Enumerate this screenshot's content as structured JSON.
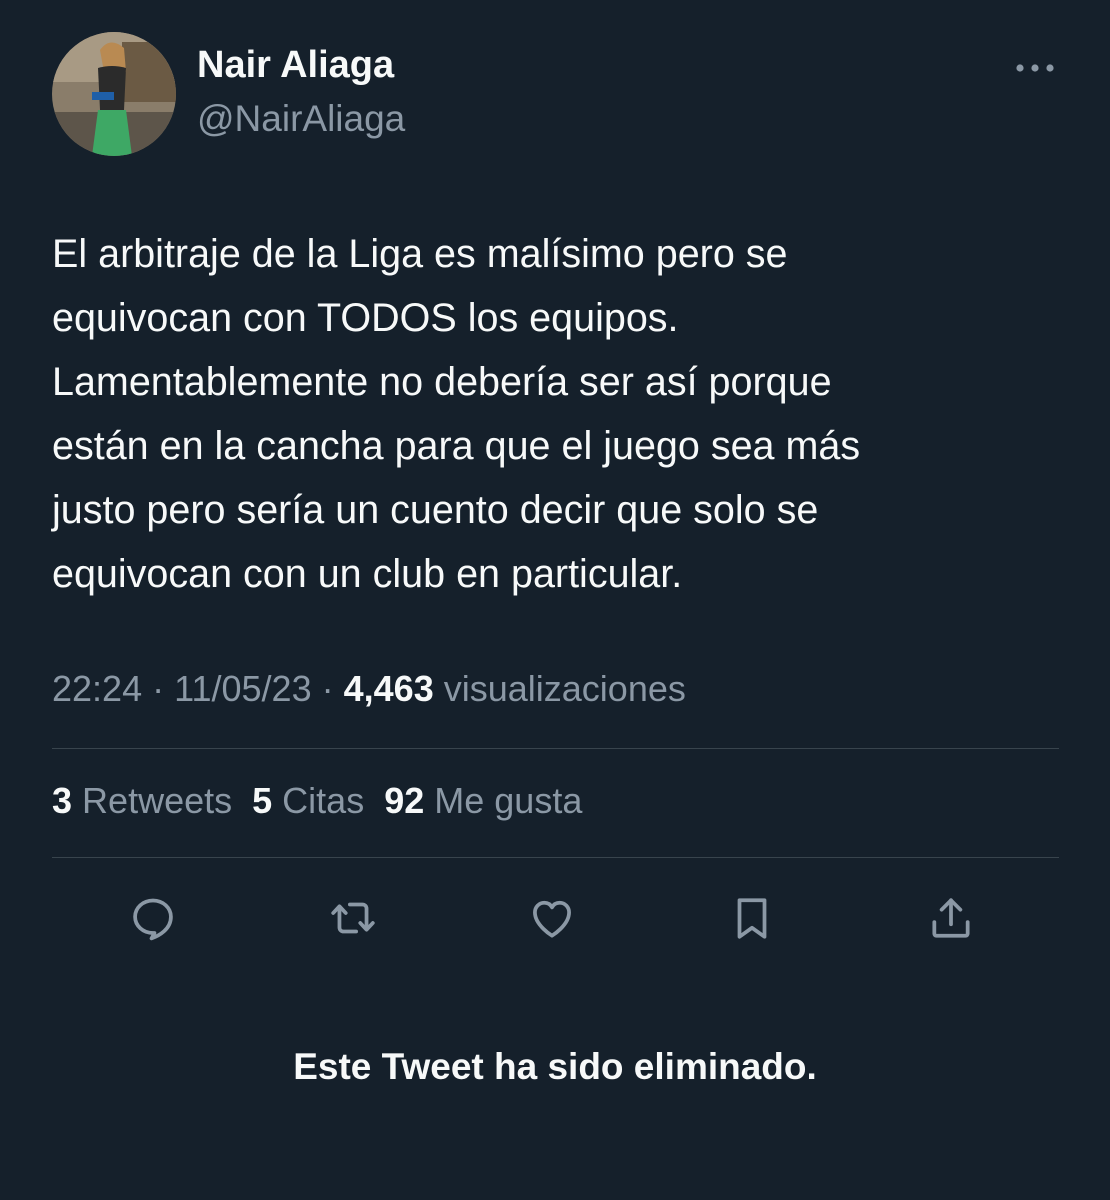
{
  "author": {
    "display_name": "Nair Aliaga",
    "handle": "@NairAliaga"
  },
  "tweet": {
    "text": "El arbitraje de la Liga es malísimo pero se\nequivocan con TODOS los equipos.\nLamentablemente no debería ser así porque\nestán en la cancha para que el juego sea más\njusto pero sería un cuento decir que solo se\nequivocan con un club en particular.",
    "time": "22:24",
    "date": "11/05/23",
    "views_count": "4,463",
    "views_label": "visualizaciones",
    "separator": "·"
  },
  "stats": {
    "retweets_count": "3",
    "retweets_label": "Retweets",
    "quotes_count": "5",
    "quotes_label": "Citas",
    "likes_count": "92",
    "likes_label": "Me gusta"
  },
  "actions": [
    "reply-icon",
    "retweet-icon",
    "like-icon",
    "bookmark-icon",
    "share-icon"
  ],
  "notice": "Este Tweet ha sido eliminado.",
  "colors": {
    "background": "#15202b",
    "text_primary": "#f7f9f9",
    "text_secondary": "#8b98a5",
    "divider": "#38444d"
  }
}
